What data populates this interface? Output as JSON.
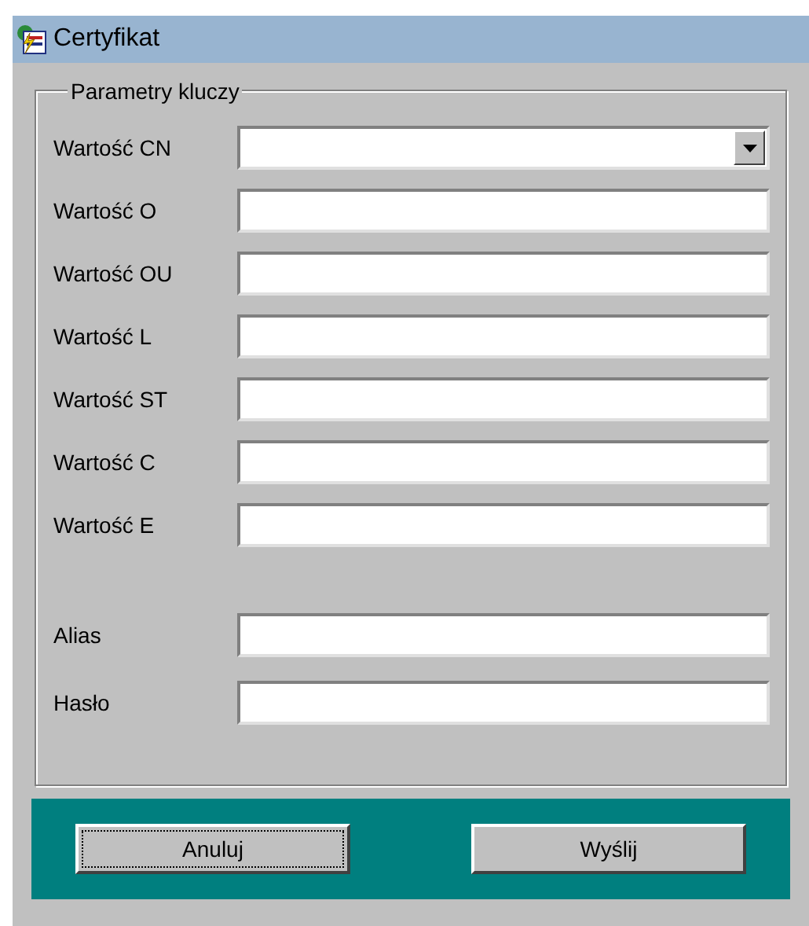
{
  "window": {
    "title": "Certyfikat"
  },
  "group": {
    "title": "Parametry kluczy",
    "fields": [
      {
        "label": "Wartość CN",
        "kind": "combo"
      },
      {
        "label": "Wartość O",
        "kind": "text"
      },
      {
        "label": "Wartość OU",
        "kind": "text"
      },
      {
        "label": "Wartość L",
        "kind": "text"
      },
      {
        "label": "Wartość ST",
        "kind": "text"
      },
      {
        "label": "Wartość C",
        "kind": "text"
      },
      {
        "label": "Wartość E",
        "kind": "text"
      }
    ],
    "credentials": [
      {
        "label": "Alias"
      },
      {
        "label": "Hasło"
      }
    ]
  },
  "buttons": [
    {
      "label": "Anuluj",
      "focused": true
    },
    {
      "label": "Wyślij",
      "focused": false
    }
  ]
}
